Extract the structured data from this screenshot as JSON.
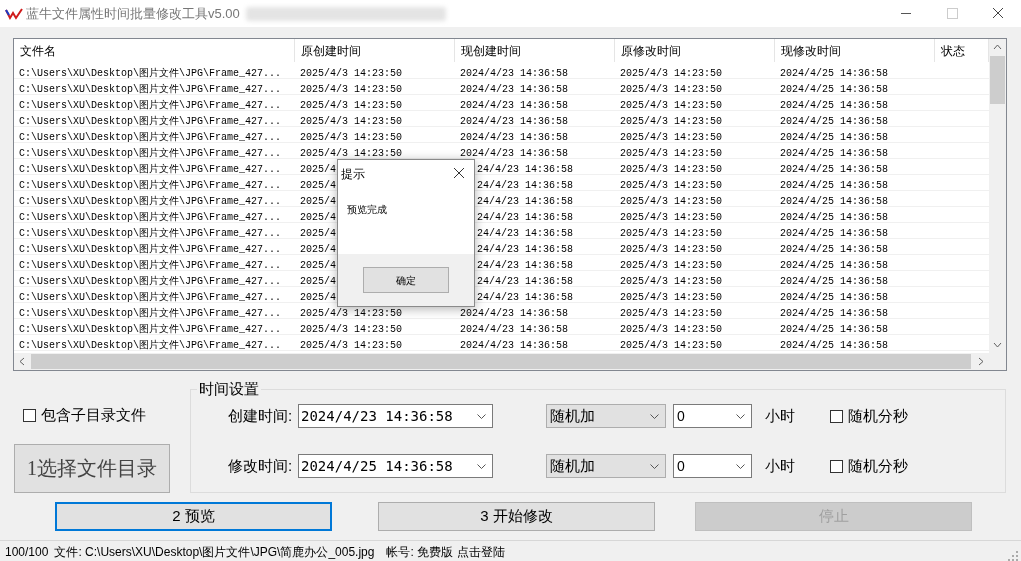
{
  "window": {
    "title": "蓝牛文件属性时间批量修改工具v5.00"
  },
  "table": {
    "columns": [
      "文件名",
      "原创建时间",
      "现创建时间",
      "原修改时间",
      "现修改时间",
      "状态"
    ],
    "rows": [
      [
        "C:\\Users\\XU\\Desktop\\图片文件\\JPG\\Frame_427...",
        "2025/4/3 14:23:50",
        "2024/4/23 14:36:58",
        "2025/4/3 14:23:50",
        "2024/4/25 14:36:58"
      ],
      [
        "C:\\Users\\XU\\Desktop\\图片文件\\JPG\\Frame_427...",
        "2025/4/3 14:23:50",
        "2024/4/23 14:36:58",
        "2025/4/3 14:23:50",
        "2024/4/25 14:36:58"
      ],
      [
        "C:\\Users\\XU\\Desktop\\图片文件\\JPG\\Frame_427...",
        "2025/4/3 14:23:50",
        "2024/4/23 14:36:58",
        "2025/4/3 14:23:50",
        "2024/4/25 14:36:58"
      ],
      [
        "C:\\Users\\XU\\Desktop\\图片文件\\JPG\\Frame_427...",
        "2025/4/3 14:23:50",
        "2024/4/23 14:36:58",
        "2025/4/3 14:23:50",
        "2024/4/25 14:36:58"
      ],
      [
        "C:\\Users\\XU\\Desktop\\图片文件\\JPG\\Frame_427...",
        "2025/4/3 14:23:50",
        "2024/4/23 14:36:58",
        "2025/4/3 14:23:50",
        "2024/4/25 14:36:58"
      ],
      [
        "C:\\Users\\XU\\Desktop\\图片文件\\JPG\\Frame_427...",
        "2025/4/3 14:23:50",
        "2024/4/23 14:36:58",
        "2025/4/3 14:23:50",
        "2024/4/25 14:36:58"
      ],
      [
        "C:\\Users\\XU\\Desktop\\图片文件\\JPG\\Frame_427...",
        "2025/4",
        "24/4/23 14:36:58",
        "2025/4/3 14:23:50",
        "2024/4/25 14:36:58"
      ],
      [
        "C:\\Users\\XU\\Desktop\\图片文件\\JPG\\Frame_427...",
        "2025/4",
        "24/4/23 14:36:58",
        "2025/4/3 14:23:50",
        "2024/4/25 14:36:58"
      ],
      [
        "C:\\Users\\XU\\Desktop\\图片文件\\JPG\\Frame_427...",
        "2025/4",
        "24/4/23 14:36:58",
        "2025/4/3 14:23:50",
        "2024/4/25 14:36:58"
      ],
      [
        "C:\\Users\\XU\\Desktop\\图片文件\\JPG\\Frame_427...",
        "2025/4",
        "24/4/23 14:36:58",
        "2025/4/3 14:23:50",
        "2024/4/25 14:36:58"
      ],
      [
        "C:\\Users\\XU\\Desktop\\图片文件\\JPG\\Frame_427...",
        "2025/4",
        "24/4/23 14:36:58",
        "2025/4/3 14:23:50",
        "2024/4/25 14:36:58"
      ],
      [
        "C:\\Users\\XU\\Desktop\\图片文件\\JPG\\Frame_427...",
        "2025/4",
        "24/4/23 14:36:58",
        "2025/4/3 14:23:50",
        "2024/4/25 14:36:58"
      ],
      [
        "C:\\Users\\XU\\Desktop\\图片文件\\JPG\\Frame_427...",
        "2025/4",
        "24/4/23 14:36:58",
        "2025/4/3 14:23:50",
        "2024/4/25 14:36:58"
      ],
      [
        "C:\\Users\\XU\\Desktop\\图片文件\\JPG\\Frame_427...",
        "2025/4",
        "24/4/23 14:36:58",
        "2025/4/3 14:23:50",
        "2024/4/25 14:36:58"
      ],
      [
        "C:\\Users\\XU\\Desktop\\图片文件\\JPG\\Frame_427...",
        "2025/4",
        "24/4/23 14:36:58",
        "2025/4/3 14:23:50",
        "2024/4/25 14:36:58"
      ],
      [
        "C:\\Users\\XU\\Desktop\\图片文件\\JPG\\Frame_427...",
        "2025/4/3 14:23:50",
        "2024/4/23 14:36:58",
        "2025/4/3 14:23:50",
        "2024/4/25 14:36:58"
      ],
      [
        "C:\\Users\\XU\\Desktop\\图片文件\\JPG\\Frame_427...",
        "2025/4/3 14:23:50",
        "2024/4/23 14:36:58",
        "2025/4/3 14:23:50",
        "2024/4/25 14:36:58"
      ],
      [
        "C:\\Users\\XU\\Desktop\\图片文件\\JPG\\Frame_427...",
        "2025/4/3 14:23:50",
        "2024/4/23 14:36:58",
        "2025/4/3 14:23:50",
        "2024/4/25 14:36:58"
      ]
    ]
  },
  "include_subdirs": {
    "label": "包含子目录文件",
    "checked": false
  },
  "select_dir_button": "1选择文件目录",
  "time_settings": {
    "title": "时间设置",
    "rows": [
      {
        "label": "创建时间:",
        "value": "2024/4/23 14:36:58",
        "mode": "随机加",
        "hours": "0",
        "unit": "小时",
        "random": {
          "label": "随机分秒",
          "checked": false
        }
      },
      {
        "label": "修改时间:",
        "value": "2024/4/25 14:36:58",
        "mode": "随机加",
        "hours": "0",
        "unit": "小时",
        "random": {
          "label": "随机分秒",
          "checked": false
        }
      }
    ]
  },
  "buttons": [
    {
      "label": "2 预览",
      "focused": true,
      "disabled": false
    },
    {
      "label": "3 开始修改",
      "focused": false,
      "disabled": false
    },
    {
      "label": "停止",
      "focused": false,
      "disabled": true
    }
  ],
  "status_bar": {
    "progress": "100/100",
    "file": "文件: C:\\Users\\XU\\Desktop\\图片文件\\JPG\\简鹿办公_005.jpg",
    "account": "帐号: 免费版",
    "login": "点击登陆"
  },
  "dialog": {
    "title": "提示",
    "message": "预览完成",
    "button": "确定"
  }
}
